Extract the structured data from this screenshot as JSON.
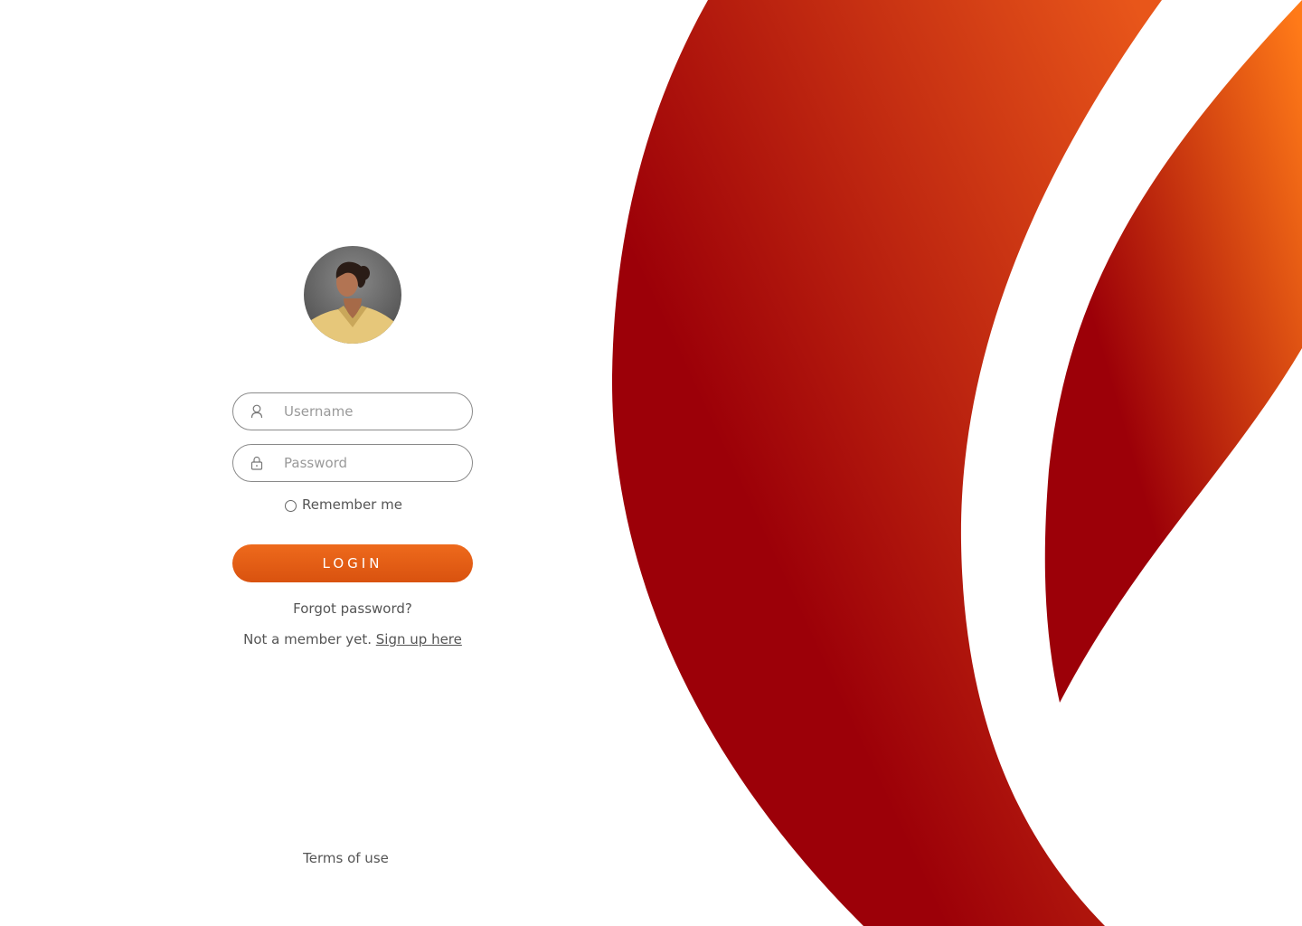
{
  "login": {
    "username": {
      "placeholder": "Username",
      "value": "",
      "icon": "user-icon"
    },
    "password": {
      "placeholder": "Password",
      "value": "",
      "icon": "lock-icon"
    },
    "remember_label": "Remember me",
    "login_label": "LOGIN",
    "forgot_label": "Forgot password?",
    "not_member_text": "Not a member yet.",
    "signup_label": "Sign up here"
  },
  "footer": {
    "terms_label": "Terms of use"
  },
  "colors": {
    "accent": "#E85F15",
    "brand_dark_red": "#9C0008",
    "brand_orange": "#FF7A18",
    "text": "#555555",
    "field_border": "#8A8A8A"
  }
}
